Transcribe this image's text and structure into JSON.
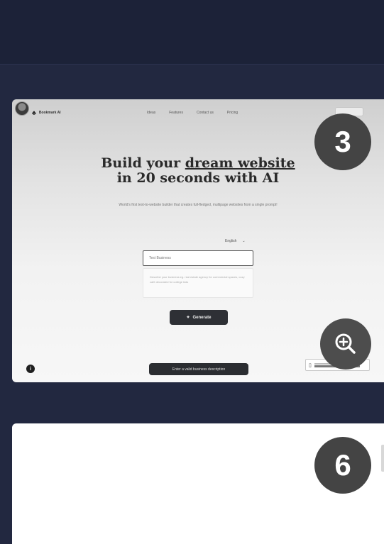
{
  "preview": {
    "brand": "Bookmark AI",
    "nav": [
      "Ideas",
      "Features",
      "Contact us",
      "Pricing"
    ],
    "headline_line1_a": "Build your ",
    "headline_line1_b": "dream website",
    "headline_line2": "in 20 seconds with AI",
    "subtitle": "World's first text-to-website builder that creates full-fledged, multipage websites from a single prompt!",
    "language": "English",
    "business_input_value": "Test Business",
    "description_placeholder": "Describe your business eg. real estate agency for commercial spaces, cozy café decorated for college kids",
    "generate_label": "Generate",
    "info_label": "i",
    "toast": "Enter a valid business description"
  },
  "overlays": {
    "card1_number": "3",
    "card2_number": "6"
  },
  "icons": {
    "zoom": "zoom-in-icon",
    "sparkle": "sparkle-icon",
    "chevron": "chevron-down-icon"
  },
  "colors": {
    "background": "#222840",
    "circle": "#444444",
    "button": "#2e3035"
  }
}
